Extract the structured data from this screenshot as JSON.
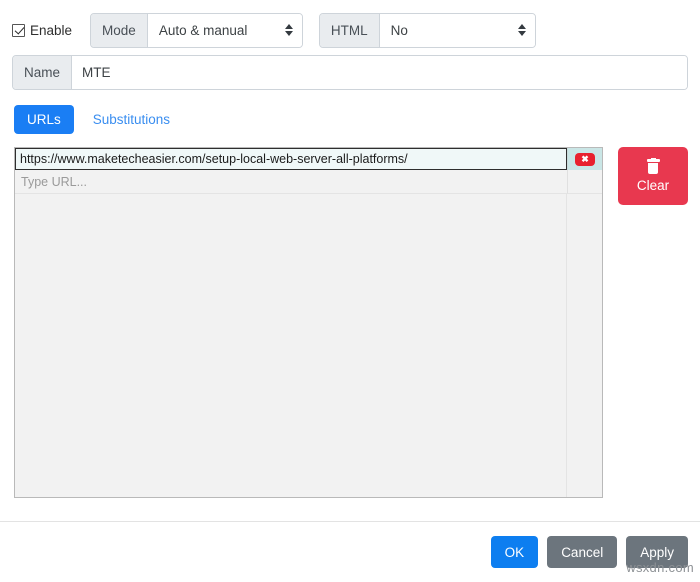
{
  "toolbar": {
    "enable_label": "Enable",
    "enable_checked": true,
    "mode_label": "Mode",
    "mode_value": "Auto & manual",
    "html_label": "HTML",
    "html_value": "No"
  },
  "name_field": {
    "label": "Name",
    "value": "MTE"
  },
  "tabs": [
    {
      "label": "URLs",
      "active": true
    },
    {
      "label": "Substitutions",
      "active": false
    }
  ],
  "url_list": {
    "rows": [
      {
        "url": "https://www.maketecheasier.com/setup-local-web-server-all-platforms/",
        "selected": true,
        "delete_glyph": "✖"
      }
    ],
    "placeholder": "Type URL..."
  },
  "clear_button": {
    "label": "Clear",
    "color": "#e8384f"
  },
  "footer": {
    "ok_label": "OK",
    "cancel_label": "Cancel",
    "apply_label": "Apply",
    "ok_color": "#0d7ef0",
    "secondary_color": "#6c757d"
  },
  "watermark": "wsxdn.com"
}
